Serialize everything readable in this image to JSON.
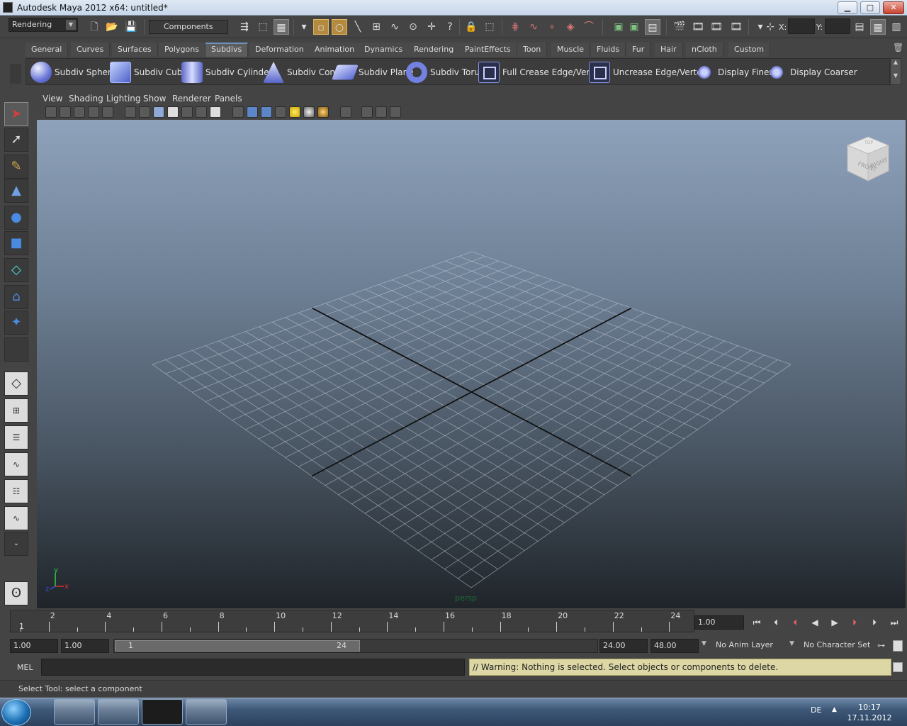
{
  "window": {
    "title": "Autodesk Maya 2012 x64: untitled*"
  },
  "statusline": {
    "menuset": "Rendering",
    "selection_mode": "Components",
    "x_label": "X:",
    "y_label": "Y:"
  },
  "shelf": {
    "tabs": [
      "General",
      "Curves",
      "Surfaces",
      "Polygons",
      "Subdivs",
      "Deformation",
      "Animation",
      "Dynamics",
      "Rendering",
      "PaintEffects",
      "Toon",
      "Muscle",
      "Fluids",
      "Fur",
      "Hair",
      "nCloth",
      "Custom"
    ],
    "active_tab": "Subdivs",
    "items": [
      {
        "label": "Subdiv Sphere",
        "icon": "subdiv-sphere-icon"
      },
      {
        "label": "Subdiv Cube",
        "icon": "subdiv-cube-icon"
      },
      {
        "label": "Subdiv Cylinder",
        "icon": "subdiv-cylinder-icon"
      },
      {
        "label": "Subdiv Cone",
        "icon": "subdiv-cone-icon"
      },
      {
        "label": "Subdiv Plane",
        "icon": "subdiv-plane-icon"
      },
      {
        "label": "Subdiv Torus",
        "icon": "subdiv-torus-icon"
      },
      {
        "label": "Full Crease Edge/Vertex",
        "icon": "full-crease-icon"
      },
      {
        "label": "Uncrease Edge/Vertex",
        "icon": "uncrease-icon"
      },
      {
        "label": "Display Finer",
        "icon": "display-finer-icon"
      },
      {
        "label": "Display Coarser",
        "icon": "display-coarser-icon"
      }
    ]
  },
  "panel": {
    "menus": [
      "View",
      "Shading",
      "Lighting",
      "Show",
      "Renderer",
      "Panels"
    ],
    "camera": "persp",
    "viewcube": {
      "front": "FRONT",
      "right": "RIGHT",
      "top": "TOP"
    },
    "axis": {
      "x": "x",
      "y": "y",
      "z": "z"
    }
  },
  "timeline": {
    "ticks": [
      "2",
      "4",
      "6",
      "8",
      "10",
      "12",
      "14",
      "16",
      "18",
      "20",
      "22",
      "24"
    ],
    "start_marker": "1",
    "current_time": "1.00"
  },
  "range": {
    "start": "1.00",
    "playback_start": "1.00",
    "slider_min": "1",
    "slider_max": "24",
    "playback_end": "24.00",
    "end": "48.00",
    "anim_layer": "No Anim Layer",
    "character_set": "No Character Set"
  },
  "commandline": {
    "label": "MEL",
    "warning": "// Warning: Nothing is selected. Select objects or components to delete."
  },
  "helpline": {
    "text": "Select Tool: select a component"
  },
  "taskbar": {
    "language": "DE",
    "time": "10:17",
    "date": "17.11.2012"
  }
}
